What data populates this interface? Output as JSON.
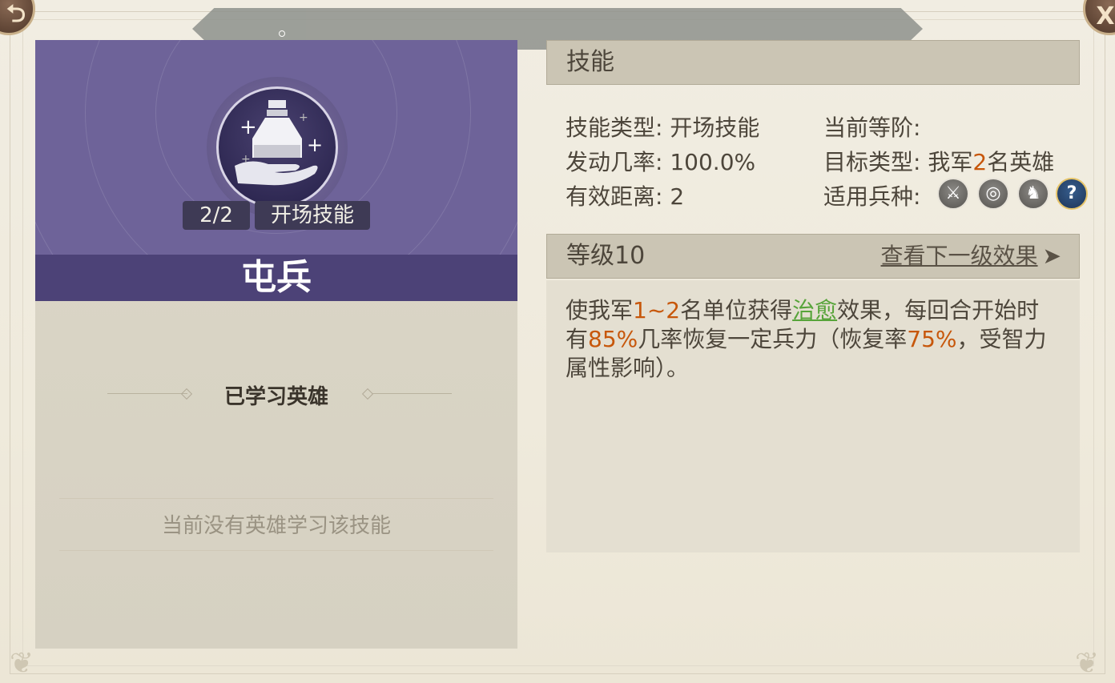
{
  "top_banner": {
    "dot": "。"
  },
  "corner_buttons": {
    "left_icon": "share-icon",
    "left_glyph": "⮌",
    "right_icon": "close-icon",
    "right_glyph": "X"
  },
  "skill": {
    "name": "屯兵",
    "progress": "2/2",
    "type_badge": "开场技能",
    "icon": "potion-hand-icon"
  },
  "learned": {
    "title": "已学习英雄",
    "empty_message": "当前没有英雄学习该技能"
  },
  "info": {
    "section_title": "技能",
    "type_label": "技能类型:",
    "type_value": "开场技能",
    "rate_label": "发动几率:",
    "rate_value": "100.0%",
    "range_label": "有效距离:",
    "range_value": "2",
    "rank_label": "当前等阶:",
    "rank_value": "",
    "target_label": "目标类型:",
    "target_prefix": "我军",
    "target_count": "2",
    "target_suffix": "名英雄",
    "troop_label": "适用兵种:",
    "troop_icons": [
      "sword-icon",
      "target-icon",
      "horse-icon",
      "help-icon"
    ],
    "troop_glyphs": [
      "⚔",
      "◎",
      "♞",
      "?"
    ]
  },
  "level": {
    "title": "等级10",
    "next_link": "查看下一级效果",
    "arrow": "➤"
  },
  "description": {
    "p1": "使我军",
    "v1": "1~2",
    "p2": "名单位获得",
    "heal": "治愈",
    "p3": "效果，每回合开始时有",
    "v2": "85%",
    "p4": "几率恢复一定兵力（恢复率",
    "v3": "75%",
    "p5": "，受智力属性影响）。"
  },
  "colors": {
    "header_purple": "#6e6399",
    "name_bar": "#4c4277",
    "highlight_orange": "#c7570b",
    "highlight_green": "#57a43a"
  }
}
